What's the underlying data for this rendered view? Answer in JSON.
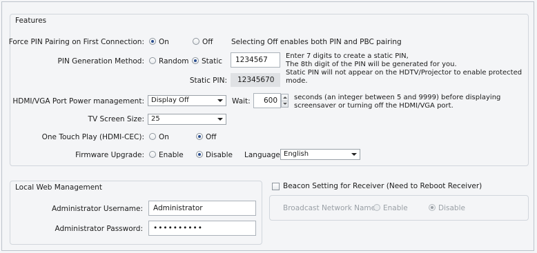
{
  "features": {
    "title": "Features",
    "force_pin": {
      "label": "Force PIN Pairing on First Connection:",
      "on_label": "On",
      "off_label": "Off",
      "selected": "On",
      "note": "Selecting Off enables both PIN and PBC pairing"
    },
    "pin_method": {
      "label": "PIN Generation Method:",
      "random_label": "Random",
      "static_label": "Static",
      "selected": "Static",
      "static_input_value": "1234567",
      "hint_line1": "Enter 7 digits to create a static PIN,",
      "hint_line2": "The 8th digit of the PIN will be generated for you.",
      "hint_line3": "Static PIN will not appear on the HDTV/Projector to enable protected mode.",
      "static_pin_label": "Static PIN:",
      "static_pin_value": "12345670"
    },
    "hdmi_power": {
      "label": "HDMI/VGA Port Power management:",
      "selected_value": "Display Off",
      "wait_label": "Wait:",
      "wait_value": "600",
      "hint_line1": "seconds (an integer between 5 and 9999) before displaying",
      "hint_line2": "screensaver or turning off the HDMI/VGA port."
    },
    "tv_screen": {
      "label": "TV Screen Size:",
      "selected_value": "25"
    },
    "one_touch": {
      "label": "One Touch Play (HDMI-CEC):",
      "on_label": "On",
      "off_label": "Off",
      "selected": "Off"
    },
    "firmware": {
      "label": "Firmware Upgrade:",
      "enable_label": "Enable",
      "disable_label": "Disable",
      "selected": "Disable",
      "language_label": "Language:",
      "language_value": "English"
    }
  },
  "local_web": {
    "title": "Local Web Management",
    "username_label": "Administrator Username:",
    "username_value": "Administrator",
    "password_label": "Administrator Password:",
    "password_value": "••••••••••"
  },
  "beacon": {
    "title": "Beacon Setting for Receiver (Need to Reboot Receiver)",
    "checked": false,
    "broadcast_label": "Broadcast Network Name:",
    "enable_label": "Enable",
    "disable_label": "Disable",
    "selected": "Disable"
  },
  "colors": {
    "radio_selected": "#2a4e8f",
    "panel_bg": "#f4f5f7",
    "readonly_bg": "#dfe1e4",
    "disabled_text": "#9aa0a6"
  }
}
